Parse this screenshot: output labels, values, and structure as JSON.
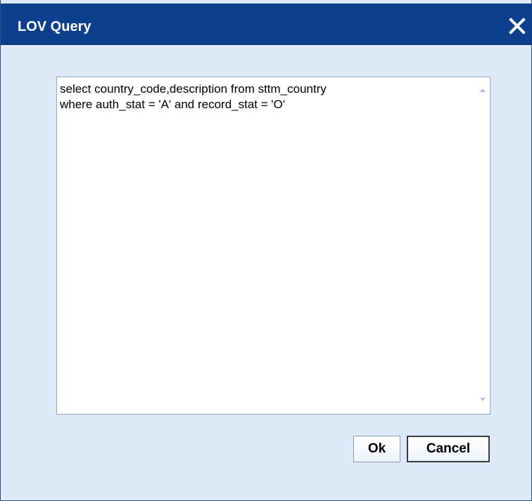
{
  "dialog": {
    "title": "LOV Query",
    "close_icon": "close-icon",
    "query": {
      "value": "select country_code,description from sttm_country\nwhere auth_stat = 'A' and record_stat = 'O'"
    },
    "buttons": {
      "ok_label": "Ok",
      "cancel_label": "Cancel"
    },
    "colors": {
      "title_bar": "#0d3f8c",
      "body": "#dde8f8"
    }
  }
}
